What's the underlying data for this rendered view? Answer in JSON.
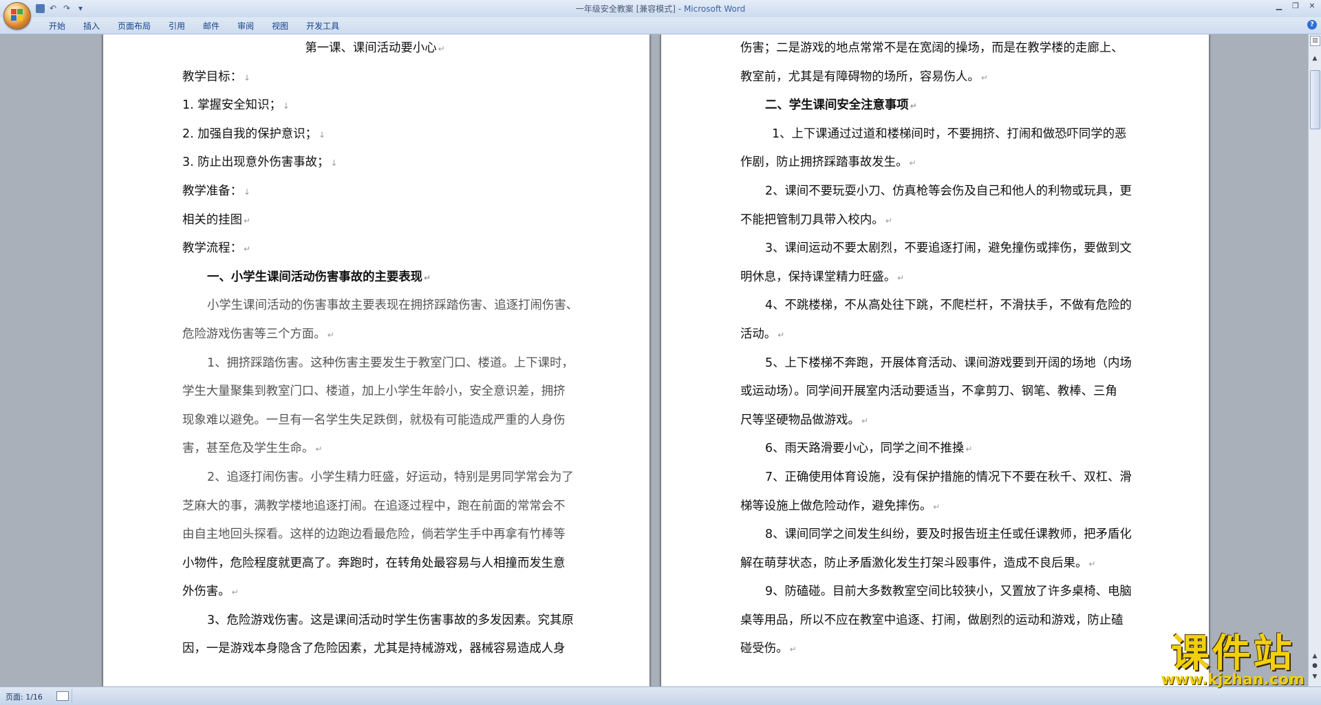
{
  "window": {
    "doc_title": "一年级安全教案 [兼容模式]",
    "separator": " - ",
    "app_name": "Microsoft Word"
  },
  "ribbon": {
    "tabs": [
      "开始",
      "插入",
      "页面布局",
      "引用",
      "邮件",
      "审阅",
      "视图",
      "开发工具"
    ]
  },
  "left_page": {
    "lines": [
      {
        "text": "第一课、课间活动要小心",
        "style": "center",
        "mark": "↵"
      },
      {
        "text": "教学目标：",
        "style": "",
        "mark": "↓"
      },
      {
        "text": "1. 掌握安全知识；",
        "style": "",
        "mark": "↓"
      },
      {
        "text": "2. 加强自我的保护意识；",
        "style": "",
        "mark": "↓"
      },
      {
        "text": "3. 防止出现意外伤害事故；",
        "style": "",
        "mark": "↓"
      },
      {
        "text": "教学准备：",
        "style": "",
        "mark": "↓"
      },
      {
        "text": "相关的挂图",
        "style": "",
        "mark": "↵"
      },
      {
        "text": "教学流程：",
        "style": "",
        "mark": "↵"
      },
      {
        "text": "一、小学生课间活动伤害事故的主要表现",
        "style": "bold ind1",
        "mark": "↵"
      },
      {
        "text": "小学生课间活动的伤害事故主要表现在拥挤踩踏伤害、追逐打闹伤害、",
        "style": "gray ind1",
        "mark": ""
      },
      {
        "text": "危险游戏伤害等三个方面。",
        "style": "gray",
        "mark": "↵"
      },
      {
        "text": "1、拥挤踩踏伤害。这种伤害主要发生于教室门口、楼道。上下课时，",
        "style": "gray ind1",
        "mark": ""
      },
      {
        "text": "学生大量聚集到教室门口、楼道，加上小学生年龄小，安全意识差，拥挤",
        "style": "gray",
        "mark": ""
      },
      {
        "text": "现象难以避免。一旦有一名学生失足跌倒，就极有可能造成严重的人身伤",
        "style": "gray",
        "mark": ""
      },
      {
        "text": "害，甚至危及学生生命。",
        "style": "gray",
        "mark": "↵"
      },
      {
        "text": "2、追逐打闹伤害。小学生精力旺盛，好运动，特别是男同学常会为了",
        "style": "gray ind1",
        "mark": ""
      },
      {
        "text": "芝麻大的事，满教学楼地追逐打闹。在追逐过程中，跑在前面的常常会不",
        "style": "gray",
        "mark": ""
      },
      {
        "text": "由自主地回头探看。这样的边跑边看最危险，倘若学生手中再拿有竹棒等",
        "style": "gray",
        "mark": ""
      },
      {
        "text": "小物件，危险程度就更高了。奔跑时，在转角处最容易与人相撞而发生意",
        "style": "",
        "mark": ""
      },
      {
        "text": "外伤害。",
        "style": "",
        "mark": "↵"
      },
      {
        "text": "3、危险游戏伤害。这是课间活动时学生伤害事故的多发因素。究其原",
        "style": "ind1",
        "mark": ""
      },
      {
        "text": "因，一是游戏本身隐含了危险因素，尤其是持械游戏，器械容易造成人身",
        "style": "",
        "mark": ""
      }
    ]
  },
  "right_page": {
    "lines": [
      {
        "text": "伤害；二是游戏的地点常常不是在宽阔的操场，而是在教学楼的走廊上、",
        "style": "",
        "mark": ""
      },
      {
        "text": "教室前，尤其是有障碍物的场所，容易伤人。",
        "style": "",
        "mark": "↵"
      },
      {
        "text": "二、学生课间安全注意事项",
        "style": "bold ind1",
        "mark": "↵"
      },
      {
        "text": "1、上下课通过过道和楼梯间时，不要拥挤、打闹和做恐吓同学的恶",
        "style": "ind2",
        "mark": ""
      },
      {
        "text": "作剧，防止拥挤踩踏事故发生。",
        "style": "",
        "mark": "↵"
      },
      {
        "text": "2、课间不要玩耍小刀、仿真枪等会伤及自己和他人的利物或玩具，更",
        "style": "ind1",
        "mark": ""
      },
      {
        "text": "不能把管制刀具带入校内。",
        "style": "",
        "mark": "↵"
      },
      {
        "text": "3、课间运动不要太剧烈，不要追逐打闹，避免撞伤或摔伤，要做到文",
        "style": "ind1",
        "mark": ""
      },
      {
        "text": "明休息，保持课堂精力旺盛。",
        "style": "",
        "mark": "↵"
      },
      {
        "text": "4、不跳楼梯，不从高处往下跳，不爬栏杆，不滑扶手，不做有危险的",
        "style": "ind1",
        "mark": ""
      },
      {
        "text": "活动。",
        "style": "",
        "mark": "↵"
      },
      {
        "text": "5、上下楼梯不奔跑，开展体育活动、课间游戏要到开阔的场地（内场",
        "style": "ind1",
        "mark": ""
      },
      {
        "text": "或运动场）。同学间开展室内活动要适当，不拿剪刀、钢笔、教棒、三角",
        "style": "",
        "mark": ""
      },
      {
        "text": "尺等坚硬物品做游戏。",
        "style": "",
        "mark": "↵"
      },
      {
        "text": "6、雨天路滑要小心，同学之间不推搡",
        "style": "ind1",
        "mark": "↵"
      },
      {
        "text": "7、正确使用体育设施，没有保护措施的情况下不要在秋千、双杠、滑",
        "style": "ind1",
        "mark": ""
      },
      {
        "text": "梯等设施上做危险动作，避免摔伤。",
        "style": "",
        "mark": "↵"
      },
      {
        "text": "8、课间同学之间发生纠纷，要及时报告班主任或任课教师，把矛盾化",
        "style": "ind1",
        "mark": ""
      },
      {
        "text": "解在萌芽状态，防止矛盾激化发生打架斗殴事件，造成不良后果。",
        "style": "",
        "mark": "↵"
      },
      {
        "text": "9、防磕碰。目前大多数教室空间比较狭小，又置放了许多桌椅、电脑",
        "style": "ind1",
        "mark": ""
      },
      {
        "text": "桌等用品，所以不应在教室中追逐、打闹，做剧烈的运动和游戏，防止磕",
        "style": "",
        "mark": ""
      },
      {
        "text": "碰受伤。",
        "style": "",
        "mark": "↵"
      }
    ]
  },
  "status": {
    "page_info": "页面: 1/16"
  },
  "watermark": {
    "cn": "课件站",
    "url": "www.kjzhan.com"
  }
}
